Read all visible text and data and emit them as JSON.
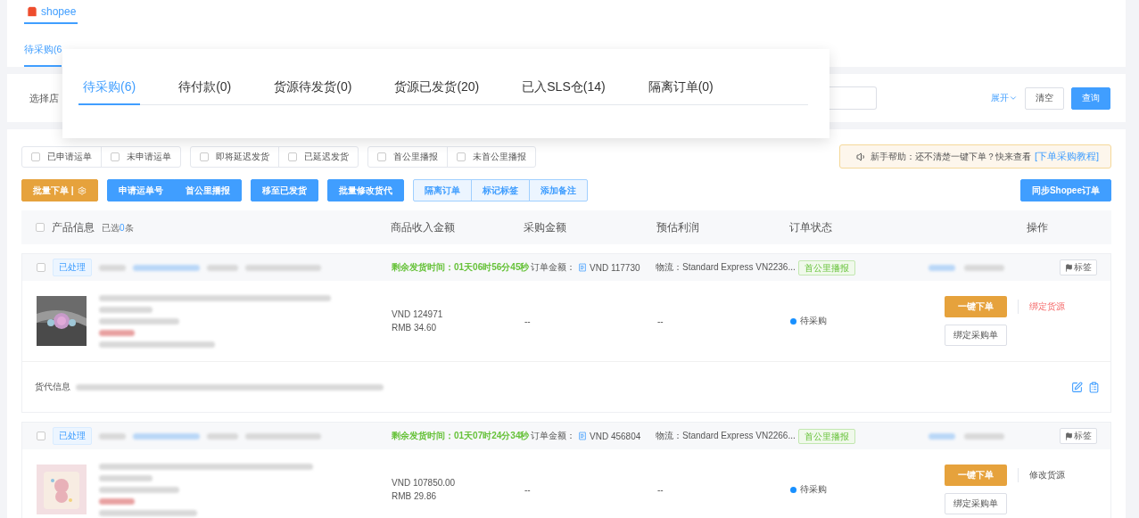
{
  "logo": {
    "text": "shopee"
  },
  "background_tabs": [
    {
      "label": "待采购(6",
      "selected": true
    }
  ],
  "filter": {
    "label": "选择店",
    "expand": "展开",
    "clear": "清空",
    "query": "查询"
  },
  "popup_tabs": [
    {
      "label": "待采购(6)",
      "selected": true
    },
    {
      "label": "待付款(0)",
      "selected": false
    },
    {
      "label": "货源待发货(0)",
      "selected": false
    },
    {
      "label": "货源已发货(20)",
      "selected": false
    },
    {
      "label": "已入SLS仓(14)",
      "selected": false
    },
    {
      "label": "隔离订单(0)",
      "selected": false
    }
  ],
  "checkbox_groups": [
    [
      {
        "label": "已申请运单",
        "checked": false
      },
      {
        "label": "未申请运单",
        "checked": false
      }
    ],
    [
      {
        "label": "即将延迟发货",
        "checked": false
      },
      {
        "label": "已延迟发货",
        "checked": false
      }
    ],
    [
      {
        "label": "首公里播报",
        "checked": false
      },
      {
        "label": "未首公里播报",
        "checked": false
      }
    ]
  ],
  "help": {
    "text": "新手帮助：还不清楚一键下单？快来查看",
    "link": "[下单采购教程]"
  },
  "action_groups": [
    {
      "kind": "warning",
      "labels": [
        "批量下单 |"
      ]
    },
    {
      "kind": "primary",
      "labels": [
        "申请运单号",
        "首公里播报"
      ]
    },
    {
      "kind": "primary",
      "labels": [
        "移至已发货"
      ]
    },
    {
      "kind": "primary",
      "labels": [
        "批量修改货代"
      ]
    },
    {
      "kind": "outline",
      "labels": [
        "隔离订单",
        "标记标签",
        "添加备注"
      ]
    }
  ],
  "sync_button": "同步Shopee订单",
  "columns": [
    {
      "label": "产品信息",
      "checked": false,
      "selected_prefix": "已选",
      "selected_count": "0",
      "selected_suffix": "条"
    },
    {
      "label": "商品收入金额"
    },
    {
      "label": "采购金额"
    },
    {
      "label": "预估利润"
    },
    {
      "label": "订单状态"
    },
    {
      "label": "操作"
    }
  ],
  "orders": [
    {
      "checked": false,
      "status_tag": "已处理",
      "countdown": "剩余发货时间：01天06时56分45秒",
      "amount_label": "订单金额：",
      "amount": "VND 117730",
      "logistics": "物流：Standard Express VN2236...",
      "badge": "首公里播报",
      "tag_button": "标签",
      "thumb": {
        "kind": "picture"
      },
      "income": [
        "VND 124971",
        "RMB 34.60"
      ],
      "purchase": "--",
      "profit": "--",
      "status": {
        "label": "待采购",
        "color": "#1890ff"
      },
      "order_button": "一键下单",
      "bind_button": "绑定采购单",
      "source_link": {
        "label": "绑定货源",
        "kind": "warning"
      },
      "forwarder": {
        "label": "货代信息"
      }
    },
    {
      "checked": false,
      "status_tag": "已处理",
      "countdown": "剩余发货时间：01天07时24分34秒",
      "amount_label": "订单金额：",
      "amount": "VND 456804",
      "logistics": "物流：Standard Express VN2266...",
      "badge": "首公里播报",
      "tag_button": "标签",
      "thumb": {
        "kind": "picture"
      },
      "income": [
        "VND 107850.00",
        "RMB 29.86"
      ],
      "purchase": "--",
      "profit": "--",
      "status": {
        "label": "待采购",
        "color": "#1890ff"
      },
      "order_button": "一键下单",
      "bind_button": "绑定采购单",
      "source_link": {
        "label": "修改货源",
        "kind": "normal"
      }
    }
  ]
}
